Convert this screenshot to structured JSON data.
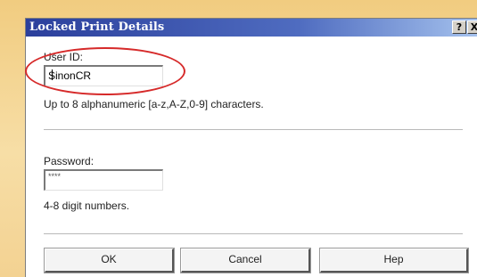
{
  "window": {
    "title": "Locked Print Details",
    "help_glyph": "?",
    "close_glyph": "X"
  },
  "user_id": {
    "label": "User ID:",
    "value": "SinonCR",
    "hint": "Up to 8 alphanumeric [a-z,A-Z,0-9] characters."
  },
  "password": {
    "label": "Password:",
    "value": "****",
    "hint": "4-8 digit numbers."
  },
  "buttons": {
    "ok": "OK",
    "cancel": "Cancel",
    "help": "Hep"
  },
  "annotation": {
    "color": "#d62a2a"
  }
}
